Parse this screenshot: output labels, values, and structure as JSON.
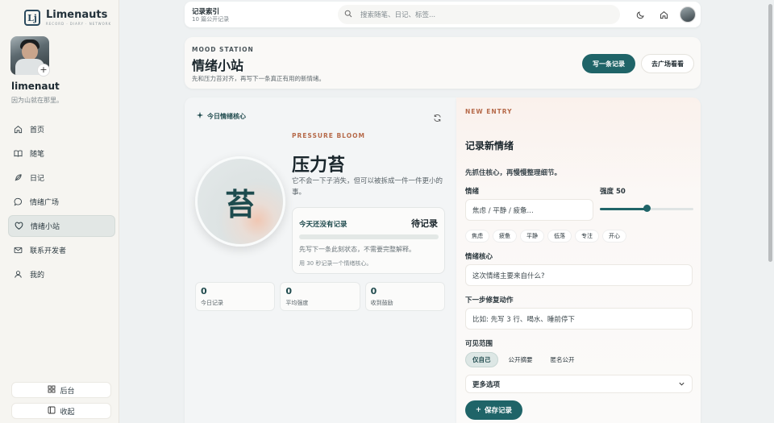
{
  "brand": {
    "name": "Limenauts",
    "mark": "Lj",
    "tagline": "RECORD · DIARY · NETWORK"
  },
  "profile": {
    "name": "limenaut",
    "signature": "因为山就在那里。",
    "add_label": "+"
  },
  "sidebar": {
    "items": [
      {
        "label": "首页",
        "icon": "home-icon",
        "active": false
      },
      {
        "label": "随笔",
        "icon": "book-open-icon",
        "active": false
      },
      {
        "label": "日记",
        "icon": "feather-icon",
        "active": false
      },
      {
        "label": "情绪广场",
        "icon": "chat-bubble-icon",
        "active": false
      },
      {
        "label": "情绪小站",
        "icon": "heart-icon",
        "active": true
      },
      {
        "label": "联系开发者",
        "icon": "mail-icon",
        "active": false
      },
      {
        "label": "我的",
        "icon": "user-icon",
        "active": false
      }
    ],
    "admin_label": "后台",
    "collapse_label": "收起"
  },
  "topbar": {
    "title": "记录索引",
    "subtitle": "10 篇公开记录",
    "search_placeholder": "搜索随笔、日记、标签..."
  },
  "header": {
    "kicker": "MOOD STATION",
    "title": "情绪小站",
    "description": "先和压力苔对齐，再写下一条真正有用的新情绪。",
    "primary_button": "写一条记录",
    "secondary_button": "去广场看看"
  },
  "core": {
    "label": "今日情绪核心",
    "glyph": "苔",
    "kicker": "PRESSURE BLOOM",
    "title": "压力苔",
    "description": "它不会一下子消失，但可以被拆成一件一件更小的事。",
    "status_label": "今天还没有记录",
    "status_value": "待记录",
    "progress": 0,
    "hint": "先写下一条此刻状态，不需要完整解释。",
    "foot": "用 30 秒记录一个情绪核心。"
  },
  "stats": [
    {
      "value": "0",
      "label": "今日记录"
    },
    {
      "value": "0",
      "label": "平均强度"
    },
    {
      "value": "0",
      "label": "收到鼓励"
    }
  ],
  "entry": {
    "kicker": "NEW ENTRY",
    "title": "记录新情绪",
    "subtitle": "先抓住核心，再慢慢整理细节。",
    "emotion_label": "情绪",
    "emotion_placeholder": "焦虑 / 平静 / 疲惫...",
    "intensity_label": "强度 50",
    "intensity": 50,
    "intensity_max": 100,
    "chips": [
      "焦虑",
      "疲惫",
      "平静",
      "低落",
      "专注",
      "开心"
    ],
    "core_label": "情绪核心",
    "core_placeholder": "这次情绪主要来自什么?",
    "next_label": "下一步修复动作",
    "next_placeholder": "比如: 先写 3 行、喝水、睡前停下",
    "visibility_label": "可见范围",
    "visibility_options": [
      {
        "label": "仅自己",
        "selected": true
      },
      {
        "label": "公开摘要",
        "selected": false
      },
      {
        "label": "匿名公开",
        "selected": false
      }
    ],
    "more_label": "更多选项",
    "save_label": "保存记录"
  },
  "colors": {
    "accent": "#1f6468",
    "kicker": "#b66a4a"
  }
}
